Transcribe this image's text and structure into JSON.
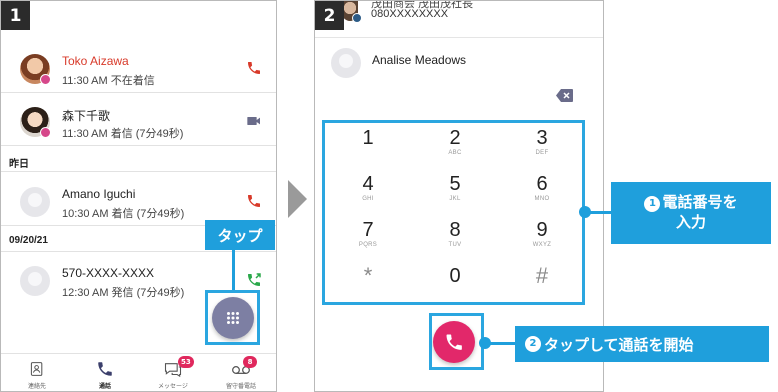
{
  "panel1": {
    "step": "1",
    "entries": [
      {
        "name": "Toko Aizawa",
        "detail": "11:30 AM 不在着信",
        "type": "missed",
        "icon": "phone-icon"
      },
      {
        "name": "森下千歌",
        "detail": "11:30 AM 着信 (7分49秒)",
        "type": "video",
        "icon": "video-icon"
      },
      {
        "name": "Amano Iguchi",
        "detail": "10:30 AM 着信 (7分49秒)",
        "type": "incoming",
        "icon": "phone-icon"
      },
      {
        "name": "570-XXXX-XXXX",
        "detail": "12:30 AM 発信 (7分49秒)",
        "type": "outgoing",
        "icon": "outgoing-call-icon"
      }
    ],
    "sections": {
      "yesterday": "昨日",
      "date": "09/20/21"
    },
    "nav": {
      "contacts": "連絡先",
      "calls": "通話",
      "messages": "メッセージ",
      "voicemail": "留守番電話",
      "messages_badge": "53",
      "voicemail_badge": "8"
    }
  },
  "panel2": {
    "step": "2",
    "top_name": "茂田商会 茂田茂社長",
    "top_number": "080XXXXXXXX",
    "contact_name": "Analise Meadows",
    "keys": [
      {
        "digit": "1",
        "letters": ""
      },
      {
        "digit": "2",
        "letters": "ABC"
      },
      {
        "digit": "3",
        "letters": "DEF"
      },
      {
        "digit": "4",
        "letters": "GHI"
      },
      {
        "digit": "5",
        "letters": "JKL"
      },
      {
        "digit": "6",
        "letters": "MNO"
      },
      {
        "digit": "7",
        "letters": "PQRS"
      },
      {
        "digit": "8",
        "letters": "TUV"
      },
      {
        "digit": "9",
        "letters": "WXYZ"
      },
      {
        "digit": "*",
        "letters": ""
      },
      {
        "digit": "0",
        "letters": ""
      },
      {
        "digit": "#",
        "letters": ""
      }
    ]
  },
  "annotations": {
    "tap": "タップ",
    "input_num": "1",
    "input_line1": "電話番号を",
    "input_line2": "入力",
    "start_num": "2",
    "start_text": "タップして通話を開始"
  },
  "colors": {
    "missed_text": "#d83a2a",
    "call_icon_red": "#d83a2a",
    "call_icon_green": "#2aa84a",
    "video_icon": "#6a6c8a",
    "presence": "#d6478a",
    "badge": "#e0285d",
    "accent_pink": "#e2286a",
    "annotation_blue": "#1f9fdc",
    "fab_gray": "#7d7fa3"
  }
}
